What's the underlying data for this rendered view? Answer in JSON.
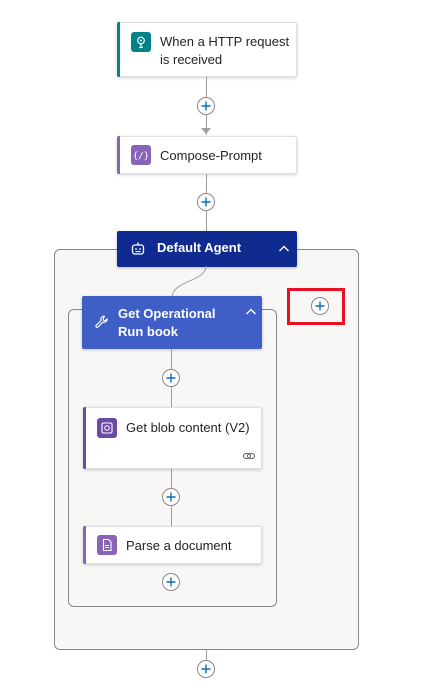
{
  "flow": {
    "trigger": {
      "label": "When a HTTP request is received",
      "icon": "http-request-icon",
      "accent": "#038387"
    },
    "compose": {
      "label": "Compose-Prompt",
      "icon": "compose-braces-icon",
      "accent": "#8764b8"
    },
    "agent": {
      "label": "Default Agent",
      "icon": "agent-robot-icon",
      "color": "#0f2b8f"
    },
    "tool": {
      "label": "Get Operational Run book",
      "icon": "wrench-icon",
      "color": "#3f5ec6"
    },
    "blob": {
      "label": "Get blob content (V2)",
      "icon": "blob-storage-icon",
      "accent": "#6b4ba5"
    },
    "parse": {
      "label": "Parse a document",
      "icon": "document-icon",
      "accent": "#8764b8"
    },
    "highlight_color": "#e81123"
  }
}
